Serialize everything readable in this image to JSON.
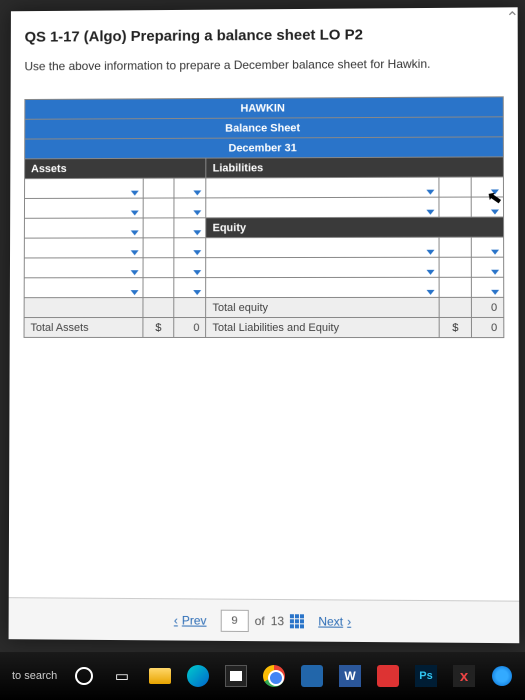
{
  "question": {
    "code": "QS 1-17 (Algo) Preparing a balance sheet LO P2",
    "instruction": "Use the above information to prepare a December balance sheet for Hawkin."
  },
  "sheet": {
    "company": "HAWKIN",
    "title": "Balance Sheet",
    "date": "December 31",
    "left_header": "Assets",
    "right_header_1": "Liabilities",
    "right_header_2": "Equity",
    "total_assets_label": "Total Assets",
    "total_equity_label": "Total equity",
    "total_liab_eq_label": "Total Liabilities and Equity",
    "currency": "$",
    "zero": "0",
    "total_assets_value": "0"
  },
  "nav": {
    "prev": "Prev",
    "next": "Next",
    "page_current": "9",
    "page_sep": "of",
    "page_total": "13"
  },
  "taskbar": {
    "search": "to search",
    "word_letter": "W",
    "ps_letters": "Ps",
    "x_letter": "x"
  }
}
